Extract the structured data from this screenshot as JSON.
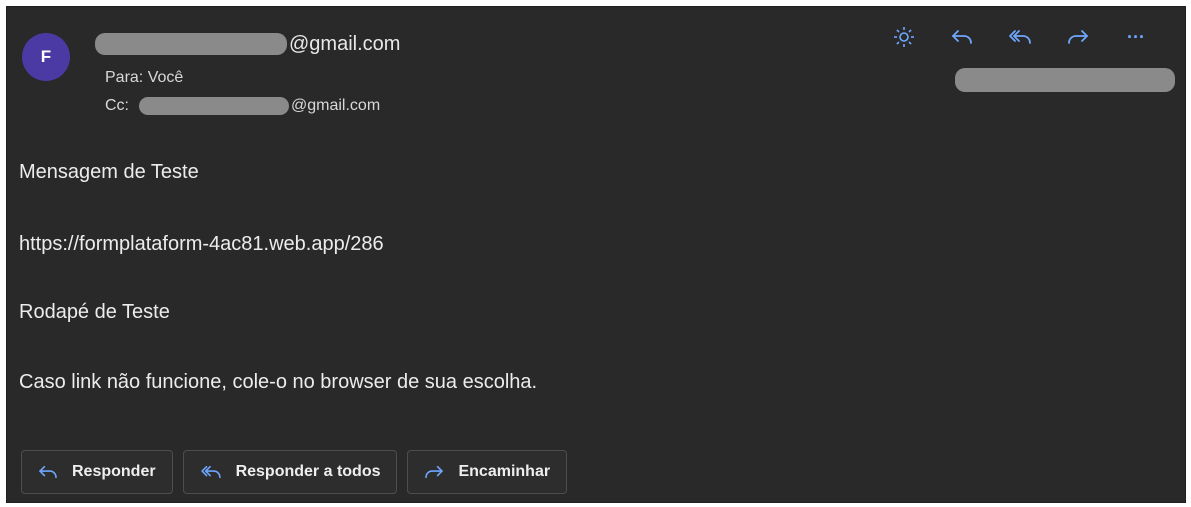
{
  "email": {
    "avatar_initial": "F",
    "from_suffix": "@gmail.com",
    "to_label": "Para: Você",
    "cc_label": "Cc:",
    "cc_suffix": "@gmail.com"
  },
  "toolbar": {
    "icons": [
      "brightness-icon",
      "reply-icon",
      "reply-all-icon",
      "forward-icon",
      "more-options-icon"
    ],
    "more_label": "···"
  },
  "body": {
    "subject": "Mensagem de Teste",
    "link": "https://formplataform-4ac81.web.app/286",
    "footer": "Rodapé de Teste",
    "note": "Caso link não funcione, cole-o no browser de sua escolha."
  },
  "actions": {
    "reply": "Responder",
    "reply_all": "Responder a todos",
    "forward": "Encaminhar"
  },
  "colors": {
    "background": "#292929",
    "accent": "#6fa6ff",
    "avatar": "#4b3aa4",
    "redaction": "#8a8a8a"
  }
}
